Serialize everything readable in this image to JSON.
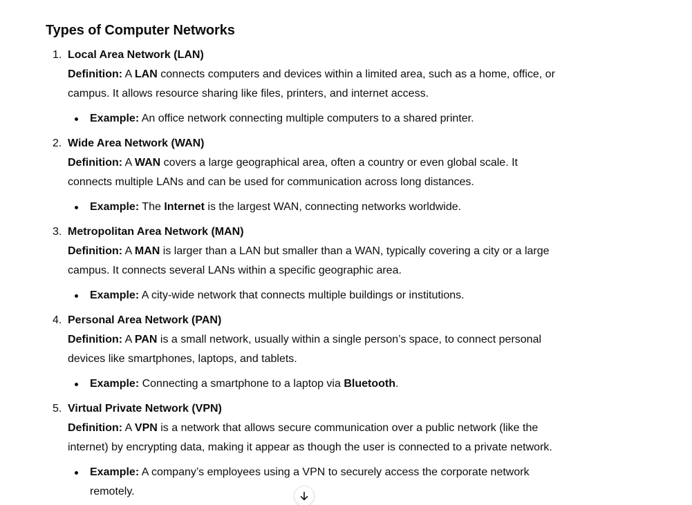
{
  "heading": "Types of Computer Networks",
  "items": [
    {
      "number": "1.",
      "title": "Local Area Network (LAN)",
      "definition_label": "Definition:",
      "definition_pre": " A ",
      "definition_term": "LAN",
      "definition_post": " connects computers and devices within a limited area, such as a home, office, or campus. It allows resource sharing like files, printers, and internet access.",
      "example_label": "Example:",
      "example_pre": " An office network connecting multiple computers to a shared printer.",
      "example_term": "",
      "example_post": ""
    },
    {
      "number": "2.",
      "title": "Wide Area Network (WAN)",
      "definition_label": "Definition:",
      "definition_pre": " A ",
      "definition_term": "WAN",
      "definition_post": " covers a large geographical area, often a country or even global scale. It connects multiple LANs and can be used for communication across long distances.",
      "example_label": "Example:",
      "example_pre": " The ",
      "example_term": "Internet",
      "example_post": " is the largest WAN, connecting networks worldwide."
    },
    {
      "number": "3.",
      "title": "Metropolitan Area Network (MAN)",
      "definition_label": "Definition:",
      "definition_pre": " A ",
      "definition_term": "MAN",
      "definition_post": " is larger than a LAN but smaller than a WAN, typically covering a city or a large campus. It connects several LANs within a specific geographic area.",
      "example_label": "Example:",
      "example_pre": " A city-wide network that connects multiple buildings or institutions.",
      "example_term": "",
      "example_post": ""
    },
    {
      "number": "4.",
      "title": "Personal Area Network (PAN)",
      "definition_label": "Definition:",
      "definition_pre": " A ",
      "definition_term": "PAN",
      "definition_post": " is a small network, usually within a single person’s space, to connect personal devices like smartphones, laptops, and tablets.",
      "example_label": "Example:",
      "example_pre": " Connecting a smartphone to a laptop via ",
      "example_term": "Bluetooth",
      "example_post": "."
    },
    {
      "number": "5.",
      "title": "Virtual Private Network (VPN)",
      "definition_label": "Definition:",
      "definition_pre": " A ",
      "definition_term": "VPN",
      "definition_post": " is a network that allows secure communication over a public network (like the internet) by encrypting data, making it appear as though the user is connected to a private network.",
      "example_label": "Example:",
      "example_pre": " A company’s employees using a VPN to securely access the corporate network remotely.",
      "example_term": "",
      "example_post": ""
    }
  ],
  "scroll_button": {
    "icon": "arrow-down-icon"
  }
}
